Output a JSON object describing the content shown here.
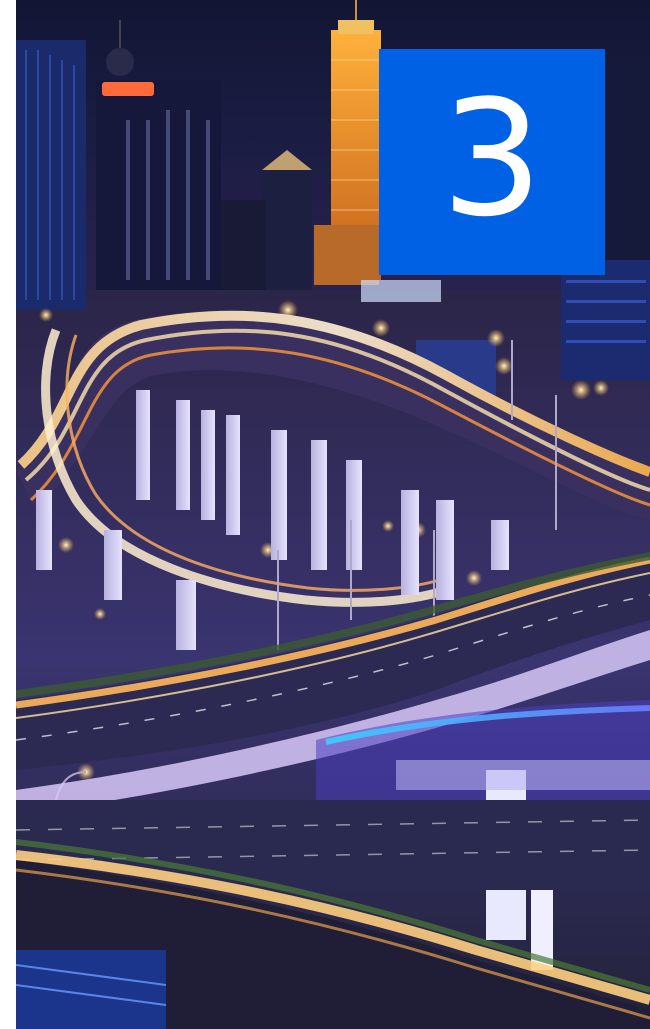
{
  "photo": {
    "description_icon": "city-interchange-night-photo"
  },
  "badge": {
    "number": "3",
    "color": "#0061e5"
  }
}
